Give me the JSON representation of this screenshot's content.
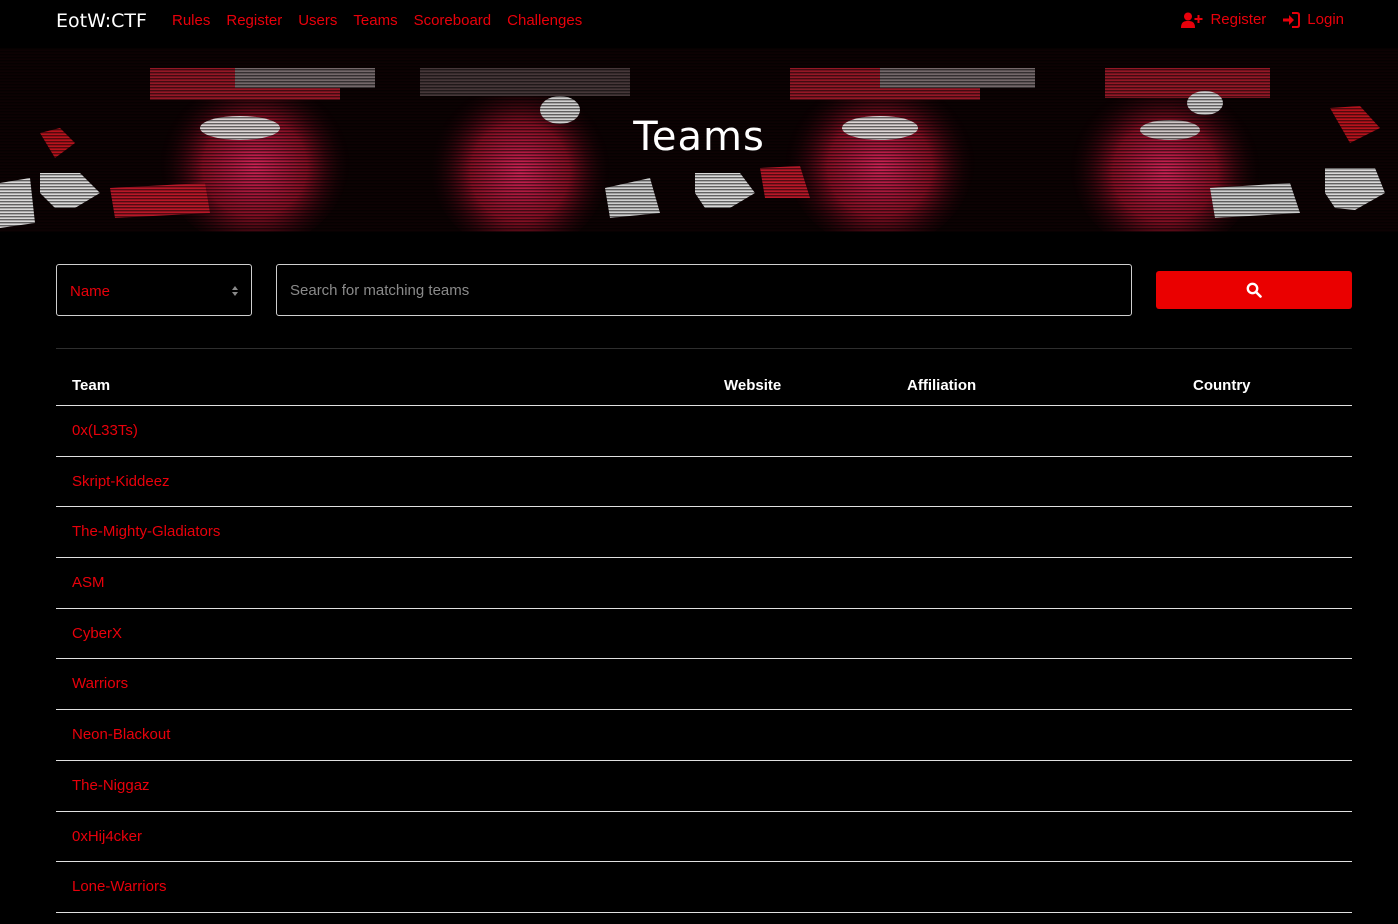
{
  "navbar": {
    "brand": "EotW:CTF",
    "links": [
      "Rules",
      "Register",
      "Users",
      "Teams",
      "Scoreboard",
      "Challenges"
    ],
    "right": {
      "register_label": "Register",
      "register_icon": "user-plus-icon",
      "login_label": "Login",
      "login_icon": "sign-in-icon"
    }
  },
  "banner": {
    "title": "Teams"
  },
  "search": {
    "field_selected": "Name",
    "placeholder": "Search for matching teams",
    "button_icon": "search-icon"
  },
  "table": {
    "headers": {
      "team": "Team",
      "website": "Website",
      "affiliation": "Affiliation",
      "country": "Country"
    },
    "rows": [
      "0x(L33Ts)",
      "Skript-Kiddeez",
      "The-Mighty-Gladiators",
      "ASM",
      "CyberX",
      "Warriors",
      "Neon-Blackout",
      "The-Niggaz",
      "0xHij4cker",
      "Lone-Warriors"
    ]
  },
  "colors": {
    "accent": "#e8000b",
    "button": "#ea0000",
    "background": "#000000"
  }
}
